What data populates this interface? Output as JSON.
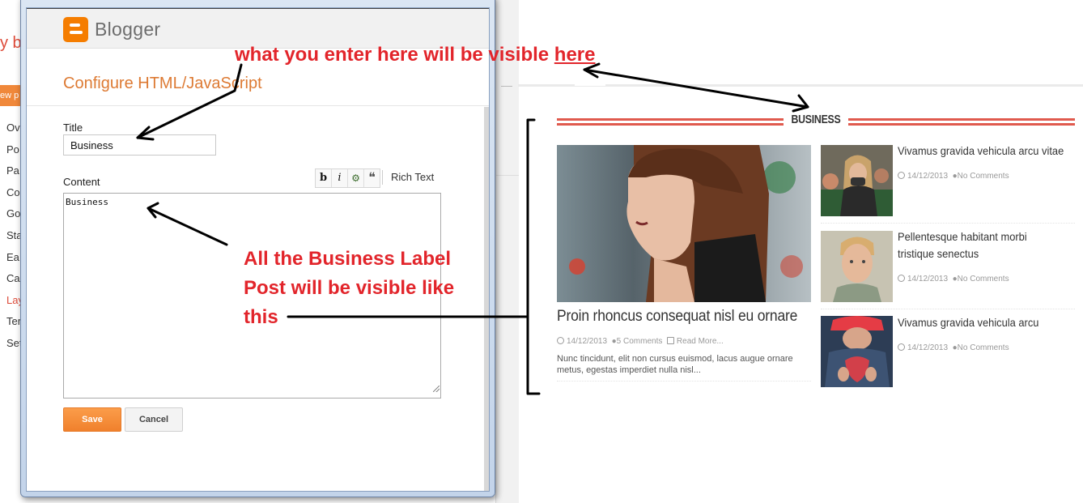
{
  "background_dashboard": {
    "title_fragment": "y b",
    "new_post_fragment": "ew p",
    "nav_items": [
      "Ov",
      "Po",
      "Pa",
      "Co",
      "Go",
      "Sta",
      "Ea",
      "Ca",
      "Lay",
      "Ter",
      "Set"
    ],
    "active_nav_item": "Lay"
  },
  "dialog": {
    "brand": "Blogger",
    "heading": "Configure HTML/JavaScript",
    "title_label": "Title",
    "title_value": "Business",
    "content_label": "Content",
    "toolbar": {
      "bold": "b",
      "italic": "i",
      "link_icon": "link-icon",
      "quote": "66",
      "rich_text": "Rich Text"
    },
    "content_value": "Business",
    "save_label": "Save",
    "cancel_label": "Cancel"
  },
  "annotations": {
    "top_text": "what you enter here will be visible",
    "top_text_end": "here",
    "side_text": "All the Business Label Post will be visible like this"
  },
  "widget": {
    "section_title": "BUSINESS",
    "main_post": {
      "title": "Proin rhoncus consequat nisl eu ornare",
      "date": "14/12/2013",
      "comments": "5 Comments",
      "read_more": "Read More...",
      "excerpt": "Nunc tincidunt, elit non cursus euismod, lacus augue ornare metus, egestas imperdiet nulla nisl..."
    },
    "side_posts": [
      {
        "title": "Vivamus gravida vehicula arcu vitae",
        "date": "14/12/2013",
        "comments": "No Comments"
      },
      {
        "title": "Pellentesque habitant morbi tristique senectus",
        "date": "14/12/2013",
        "comments": "No Comments"
      },
      {
        "title": "Vivamus gravida vehicula arcu",
        "date": "14/12/2013",
        "comments": "No Comments"
      }
    ]
  },
  "colors": {
    "blogger_orange": "#f57d00",
    "heading_orange": "#dd7a33",
    "annotation_red": "#e2252b",
    "section_red": "#e05a4e"
  }
}
